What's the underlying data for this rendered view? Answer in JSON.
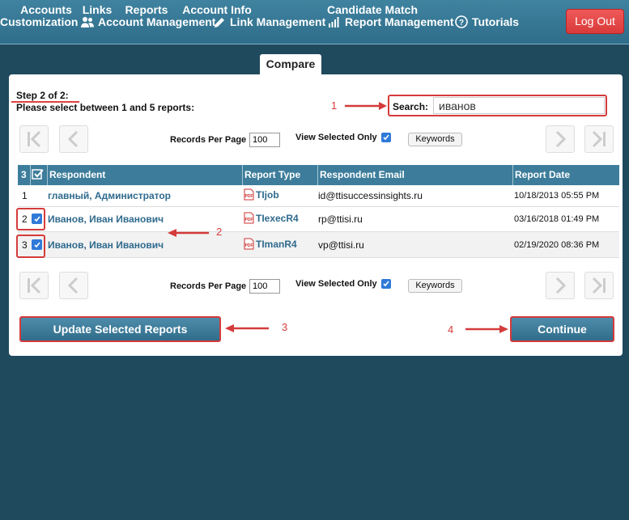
{
  "nav": {
    "customization": "Customization",
    "account_management": "Account Management",
    "link_management": "Link Management",
    "report_management": "Report Management",
    "tutorials": "Tutorials",
    "logout": "Log Out"
  },
  "tabs": [
    "Accounts",
    "Links",
    "Reports",
    "Account Info",
    "Compare",
    "Candidate Match"
  ],
  "step": {
    "title": "Step 2 of 2:",
    "instruction": "Please select between 1 and 5 reports:"
  },
  "search": {
    "label": "Search:",
    "value": "иванов"
  },
  "pager": {
    "records_per_page_label": "Records Per Page",
    "records_per_page_value": "100",
    "view_selected_only_label": "View Selected Only",
    "keywords_label": "Keywords"
  },
  "table": {
    "header": {
      "count": "3",
      "respondent": "Respondent",
      "report_type": "Report Type",
      "email": "Respondent Email",
      "date": "Report Date"
    },
    "rows": [
      {
        "index": "1",
        "respondent": "главный, Администратор",
        "report_type": "TIjob",
        "email": "id@ttisuccessinsights.ru",
        "date": "10/18/2013 05:55 PM",
        "selected": false
      },
      {
        "index": "2",
        "respondent": "Иванов, Иван Иванович",
        "report_type": "TIexecR4",
        "email": "rp@ttisi.ru",
        "date": "03/16/2018 01:49 PM",
        "selected": true
      },
      {
        "index": "3",
        "respondent": "Иванов,  Иван Иванович",
        "report_type": "TImanR4",
        "email": "vp@ttisi.ru",
        "date": "02/19/2020 08:36 PM",
        "selected": true
      }
    ]
  },
  "buttons": {
    "update": "Update Selected Reports",
    "continue": "Continue"
  },
  "annotations": [
    "1",
    "2",
    "3",
    "4"
  ],
  "colors": {
    "accent": "#3d7d9b",
    "highlight": "#d43b3b",
    "background": "#1f4a5e"
  }
}
